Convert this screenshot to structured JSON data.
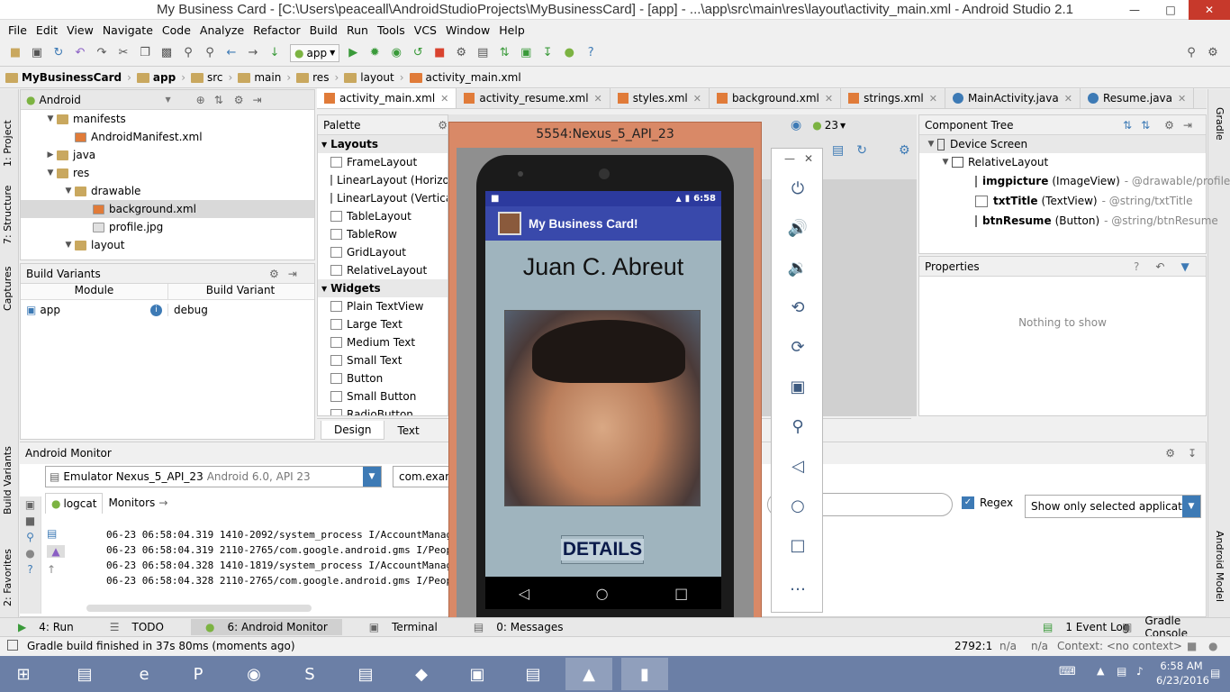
{
  "window": {
    "title": "My Business Card - [C:\\Users\\peaceall\\AndroidStudioProjects\\MyBusinessCard] - [app] - ...\\app\\src\\main\\res\\layout\\activity_main.xml - Android Studio 2.1"
  },
  "menu": [
    "File",
    "Edit",
    "View",
    "Navigate",
    "Code",
    "Analyze",
    "Refactor",
    "Build",
    "Run",
    "Tools",
    "VCS",
    "Window",
    "Help"
  ],
  "toolbar": {
    "run_config": "app"
  },
  "breadcrumb": [
    "MyBusinessCard",
    "app",
    "src",
    "main",
    "res",
    "layout",
    "activity_main.xml"
  ],
  "left_strip": {
    "project": "1: Project",
    "structure": "7: Structure",
    "captures": "Captures",
    "build_variants": "Build Variants",
    "favorites": "2: Favorites"
  },
  "right_strip": {
    "gradle": "Gradle",
    "android_model": "Android Model"
  },
  "project": {
    "view": "Android",
    "tree": [
      {
        "label": "manifests",
        "level": 1,
        "expanded": true
      },
      {
        "label": "AndroidManifest.xml",
        "level": 2
      },
      {
        "label": "java",
        "level": 1,
        "expanded": false
      },
      {
        "label": "res",
        "level": 1,
        "expanded": true
      },
      {
        "label": "drawable",
        "level": 2,
        "expanded": true
      },
      {
        "label": "background.xml",
        "level": 3,
        "selected": true
      },
      {
        "label": "profile.jpg",
        "level": 3
      },
      {
        "label": "layout",
        "level": 2,
        "expanded": true
      }
    ]
  },
  "build_variants": {
    "title": "Build Variants",
    "col_module": "Module",
    "col_variant": "Build Variant",
    "module": "app",
    "variant": "debug"
  },
  "tabs": [
    "activity_main.xml",
    "activity_resume.xml",
    "styles.xml",
    "background.xml",
    "strings.xml",
    "MainActivity.java",
    "Resume.java"
  ],
  "palette": {
    "title": "Palette",
    "sections": [
      {
        "name": "Layouts",
        "items": [
          "FrameLayout",
          "LinearLayout (Horizon",
          "LinearLayout (Vertical",
          "TableLayout",
          "TableRow",
          "GridLayout",
          "RelativeLayout"
        ]
      },
      {
        "name": "Widgets",
        "items": [
          "Plain TextView",
          "Large Text",
          "Medium Text",
          "Small Text",
          "Button",
          "Small Button",
          "RadioButton"
        ]
      }
    ]
  },
  "editor": {
    "api": "23",
    "design_tab": "Design",
    "text_tab": "Text"
  },
  "component_tree": {
    "title": "Component Tree",
    "device": "Device Screen",
    "layout": "RelativeLayout",
    "items": [
      {
        "id": "imgpicture",
        "type": "(ImageView)",
        "ref": "- @drawable/profile"
      },
      {
        "id": "txtTitle",
        "type": "(TextView)",
        "ref": "- @string/txtTitle"
      },
      {
        "id": "btnResume",
        "type": "(Button)",
        "ref": "- @string/btnResume"
      }
    ]
  },
  "properties": {
    "title": "Properties",
    "empty": "Nothing to show"
  },
  "android_monitor": {
    "title": "Android Monitor",
    "device": "Emulator Nexus_5_API_23",
    "device_info": "Android 6.0, API 23",
    "process": "com.exam",
    "tab_logcat": "logcat",
    "tab_monitors": "Monitors",
    "regex_label": "Regex",
    "filter": "Show only selected application",
    "log_lines": [
      "06-23 06:58:04.319 1410-2092/system_process I/AccountManag",
      "06-23 06:58:04.319 2110-2765/com.google.android.gms I/Peop",
      "06-23 06:58:04.328 1410-1819/system_process I/AccountManag",
      "06-23 06:58:04.328 2110-2765/com.google.android.gms I/Peop"
    ]
  },
  "emulator": {
    "title": "5554:Nexus_5_API_23",
    "time": "6:58",
    "app_title": "My Business Card!",
    "name": "Juan C. Abreut",
    "button": "DETAILS"
  },
  "bottom_tabs": {
    "run": "4: Run",
    "todo": "TODO",
    "monitor": "6: Android Monitor",
    "terminal": "Terminal",
    "messages": "0: Messages",
    "event_log": "1 Event Log",
    "gradle_console": "Gradle Console"
  },
  "status": {
    "message": "Gradle build finished in 37s 80ms (moments ago)",
    "position": "2792:1",
    "na1": "n/a",
    "na2": "n/a",
    "context": "Context: <no context>"
  },
  "taskbar": {
    "time": "6:58 AM",
    "date": "6/23/2016"
  }
}
